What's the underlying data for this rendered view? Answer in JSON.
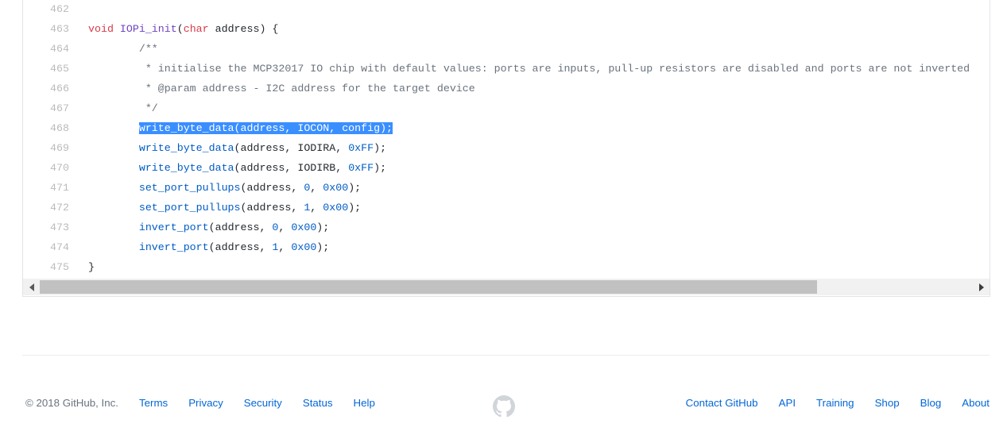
{
  "code_view": {
    "language": "c",
    "selected_line": 468,
    "lines": [
      {
        "number": "462",
        "tokens": []
      },
      {
        "number": "463",
        "tokens": [
          {
            "t": "void",
            "c": "k"
          },
          {
            "t": " ",
            "c": "pl"
          },
          {
            "t": "IOPi_init",
            "c": "fn"
          },
          {
            "t": "(",
            "c": "pl"
          },
          {
            "t": "char",
            "c": "k"
          },
          {
            "t": " address) {",
            "c": "pl"
          }
        ]
      },
      {
        "number": "464",
        "tokens": [
          {
            "t": "        /**",
            "c": "cm"
          }
        ]
      },
      {
        "number": "465",
        "tokens": [
          {
            "t": "         * initialise the MCP32017 IO chip with default values: ports are inputs, pull-up resistors are disabled and ports are not inverted",
            "c": "cm"
          }
        ]
      },
      {
        "number": "466",
        "tokens": [
          {
            "t": "         * @param address - I2C address for the target device",
            "c": "cm"
          }
        ]
      },
      {
        "number": "467",
        "tokens": [
          {
            "t": "         */",
            "c": "cm"
          }
        ]
      },
      {
        "number": "468",
        "selected": true,
        "indent": "        ",
        "tokens": [
          {
            "t": "write_byte_data",
            "c": "call"
          },
          {
            "t": "(address, IOCON, config);",
            "c": "pl"
          }
        ]
      },
      {
        "number": "469",
        "tokens": [
          {
            "t": "        ",
            "c": "pl"
          },
          {
            "t": "write_byte_data",
            "c": "call"
          },
          {
            "t": "(address, IODIRA, ",
            "c": "pl"
          },
          {
            "t": "0xFF",
            "c": "num"
          },
          {
            "t": ");",
            "c": "pl"
          }
        ]
      },
      {
        "number": "470",
        "tokens": [
          {
            "t": "        ",
            "c": "pl"
          },
          {
            "t": "write_byte_data",
            "c": "call"
          },
          {
            "t": "(address, IODIRB, ",
            "c": "pl"
          },
          {
            "t": "0xFF",
            "c": "num"
          },
          {
            "t": ");",
            "c": "pl"
          }
        ]
      },
      {
        "number": "471",
        "tokens": [
          {
            "t": "        ",
            "c": "pl"
          },
          {
            "t": "set_port_pullups",
            "c": "call"
          },
          {
            "t": "(address, ",
            "c": "pl"
          },
          {
            "t": "0",
            "c": "num"
          },
          {
            "t": ", ",
            "c": "pl"
          },
          {
            "t": "0x00",
            "c": "num"
          },
          {
            "t": ");",
            "c": "pl"
          }
        ]
      },
      {
        "number": "472",
        "tokens": [
          {
            "t": "        ",
            "c": "pl"
          },
          {
            "t": "set_port_pullups",
            "c": "call"
          },
          {
            "t": "(address, ",
            "c": "pl"
          },
          {
            "t": "1",
            "c": "num"
          },
          {
            "t": ", ",
            "c": "pl"
          },
          {
            "t": "0x00",
            "c": "num"
          },
          {
            "t": ");",
            "c": "pl"
          }
        ]
      },
      {
        "number": "473",
        "tokens": [
          {
            "t": "        ",
            "c": "pl"
          },
          {
            "t": "invert_port",
            "c": "call"
          },
          {
            "t": "(address, ",
            "c": "pl"
          },
          {
            "t": "0",
            "c": "num"
          },
          {
            "t": ", ",
            "c": "pl"
          },
          {
            "t": "0x00",
            "c": "num"
          },
          {
            "t": ");",
            "c": "pl"
          }
        ]
      },
      {
        "number": "474",
        "tokens": [
          {
            "t": "        ",
            "c": "pl"
          },
          {
            "t": "invert_port",
            "c": "call"
          },
          {
            "t": "(address, ",
            "c": "pl"
          },
          {
            "t": "1",
            "c": "num"
          },
          {
            "t": ", ",
            "c": "pl"
          },
          {
            "t": "0x00",
            "c": "num"
          },
          {
            "t": ");",
            "c": "pl"
          }
        ]
      },
      {
        "number": "475",
        "tokens": [
          {
            "t": "}",
            "c": "pl"
          }
        ]
      }
    ],
    "selection_text": "write_byte_data(address, IOCON, config);",
    "colors": {
      "keyword": "#d73a49",
      "function_def": "#6f42c1",
      "function_call": "#005cc5",
      "number": "#005cc5",
      "comment": "#6a737d",
      "plain": "#24292e",
      "selection_background": "#3a8fff",
      "selection_text": "#ffffff",
      "line_number": "#babbbd",
      "border": "#e1e4e8"
    }
  },
  "scrollbar": {
    "orientation": "horizontal",
    "left_arrow": "◀",
    "right_arrow": "▶",
    "track_color": "#f1f1f1",
    "thumb_color": "#c1c1c1"
  },
  "footer": {
    "copyright": "© 2018 GitHub, Inc.",
    "left_links": [
      {
        "label": "Terms"
      },
      {
        "label": "Privacy"
      },
      {
        "label": "Security"
      },
      {
        "label": "Status"
      },
      {
        "label": "Help"
      }
    ],
    "mark": "github-octocat-mark",
    "right_links": [
      {
        "label": "Contact GitHub"
      },
      {
        "label": "API"
      },
      {
        "label": "Training"
      },
      {
        "label": "Shop"
      },
      {
        "label": "Blog"
      },
      {
        "label": "About"
      }
    ],
    "link_color": "#0366d6",
    "text_color": "#6a737d",
    "mark_color": "#d1d5da"
  }
}
